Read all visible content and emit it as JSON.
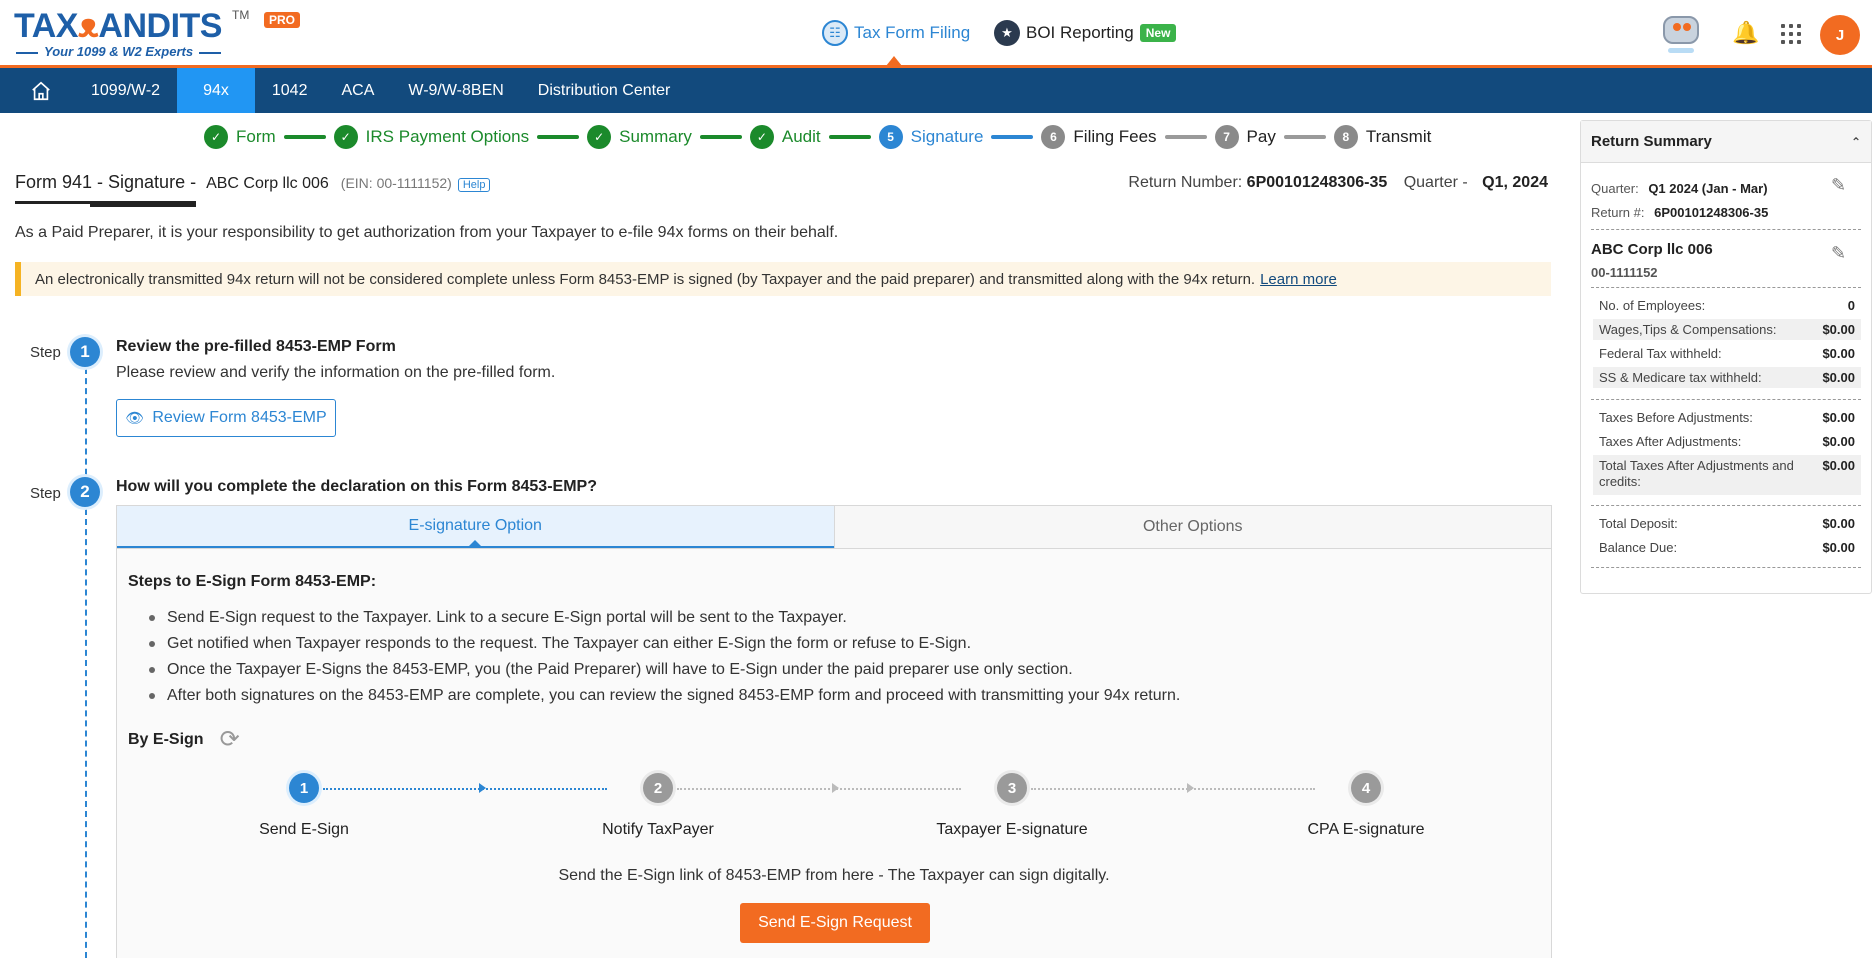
{
  "header": {
    "logo_text_left": "TAX",
    "logo_text_owl": "ᴥ",
    "logo_text_right": "ANDITS",
    "logo_tm": "TM",
    "logo_pro": "PRO",
    "logo_tagline": "Your 1099 & W2 Experts",
    "tax_form_filing": "Tax Form Filing",
    "boi_reporting": "BOI Reporting",
    "boi_badge": "New",
    "avatar_initial": "J"
  },
  "nav": {
    "items": [
      "1099/W-2",
      "94x",
      "1042",
      "ACA",
      "W-9/W-8BEN",
      "Distribution Center"
    ],
    "active_index": 1
  },
  "progress": {
    "steps": [
      {
        "num": "1",
        "label": "Form",
        "state": "done"
      },
      {
        "num": "2",
        "label": "IRS Payment Options",
        "state": "done"
      },
      {
        "num": "3",
        "label": "Summary",
        "state": "done"
      },
      {
        "num": "4",
        "label": "Audit",
        "state": "done"
      },
      {
        "num": "5",
        "label": "Signature",
        "state": "current"
      },
      {
        "num": "6",
        "label": "Filing Fees",
        "state": "todo"
      },
      {
        "num": "7",
        "label": "Pay",
        "state": "todo"
      },
      {
        "num": "8",
        "label": "Transmit",
        "state": "todo"
      }
    ]
  },
  "form_header": {
    "title": "Form 941 - Signature -",
    "company": "ABC Corp llc 006",
    "ein": "(EIN: 00-1111152)",
    "help": "Help",
    "return_number_label": "Return Number:",
    "return_number": "6P00101248306-35",
    "quarter_label": "Quarter -",
    "quarter_value": "Q1, 2024"
  },
  "intro": "As a Paid Preparer, it is your responsibility to get authorization from your Taxpayer to e-file 94x forms on their behalf.",
  "alert": {
    "text": "An electronically transmitted 94x return will not be considered complete unless Form 8453-EMP is signed (by Taxpayer and the paid preparer) and transmitted along with the 94x return.",
    "link": "Learn more"
  },
  "step_word": "Step",
  "step1": {
    "num": "1",
    "heading": "Review the pre-filled 8453-EMP Form",
    "text": "Please review and verify the information on the pre-filled form.",
    "button": "Review Form 8453-EMP"
  },
  "step2": {
    "num": "2",
    "heading": "How will you complete the declaration on this Form 8453-EMP?",
    "tabs": [
      "E-signature Option",
      "Other Options"
    ],
    "steps_heading": "Steps to E-Sign Form 8453-EMP:",
    "bullets": [
      "Send E-Sign request to the Taxpayer. Link to a secure E-Sign portal will be sent to the Taxpayer.",
      "Get notified when Taxpayer responds to the request. The Taxpayer can either E-Sign the form or refuse to E-Sign.",
      "Once the Taxpayer E-Signs the 8453-EMP, you (the Paid Preparer) will have to E-Sign under the paid preparer use only section.",
      "After both signatures on the 8453-EMP are complete, you can review the signed 8453-EMP form and proceed with transmitting your 94x return."
    ],
    "by_esign": "By E-Sign",
    "esign_steps": [
      {
        "num": "1",
        "label": "Send E-Sign"
      },
      {
        "num": "2",
        "label": "Notify TaxPayer"
      },
      {
        "num": "3",
        "label": "Taxpayer E-signature"
      },
      {
        "num": "4",
        "label": "CPA E-signature"
      }
    ],
    "esign_active": 1,
    "description": "Send the E-Sign link of 8453-EMP from here - The Taxpayer can sign digitally.",
    "send_button": "Send E-Sign Request"
  },
  "summary": {
    "title": "Return Summary",
    "quarter_label": "Quarter:",
    "quarter_value": "Q1 2024 (Jan - Mar)",
    "return_label": "Return #:",
    "return_value": "6P00101248306-35",
    "company": "ABC Corp llc 006",
    "ein": "00-1111152",
    "group1": [
      {
        "label": "No. of Employees:",
        "value": "0"
      },
      {
        "label": "Wages,Tips & Compensations:",
        "value": "$0.00"
      },
      {
        "label": "Federal Tax withheld:",
        "value": "$0.00"
      },
      {
        "label": "SS & Medicare tax withheld:",
        "value": "$0.00"
      }
    ],
    "group2": [
      {
        "label": "Taxes Before Adjustments:",
        "value": "$0.00"
      },
      {
        "label": "Taxes After Adjustments:",
        "value": "$0.00"
      },
      {
        "label": "Total Taxes After Adjustments and credits:",
        "value": "$0.00"
      }
    ],
    "group3": [
      {
        "label": "Total Deposit:",
        "value": "$0.00"
      },
      {
        "label": "Balance Due:",
        "value": "$0.00"
      }
    ]
  },
  "colors": {
    "brand_orange": "#f26b21",
    "nav_blue": "#124a7d",
    "active_blue": "#2196f3",
    "done_green": "#1b8a2b",
    "link_blue": "#2c86d3"
  }
}
